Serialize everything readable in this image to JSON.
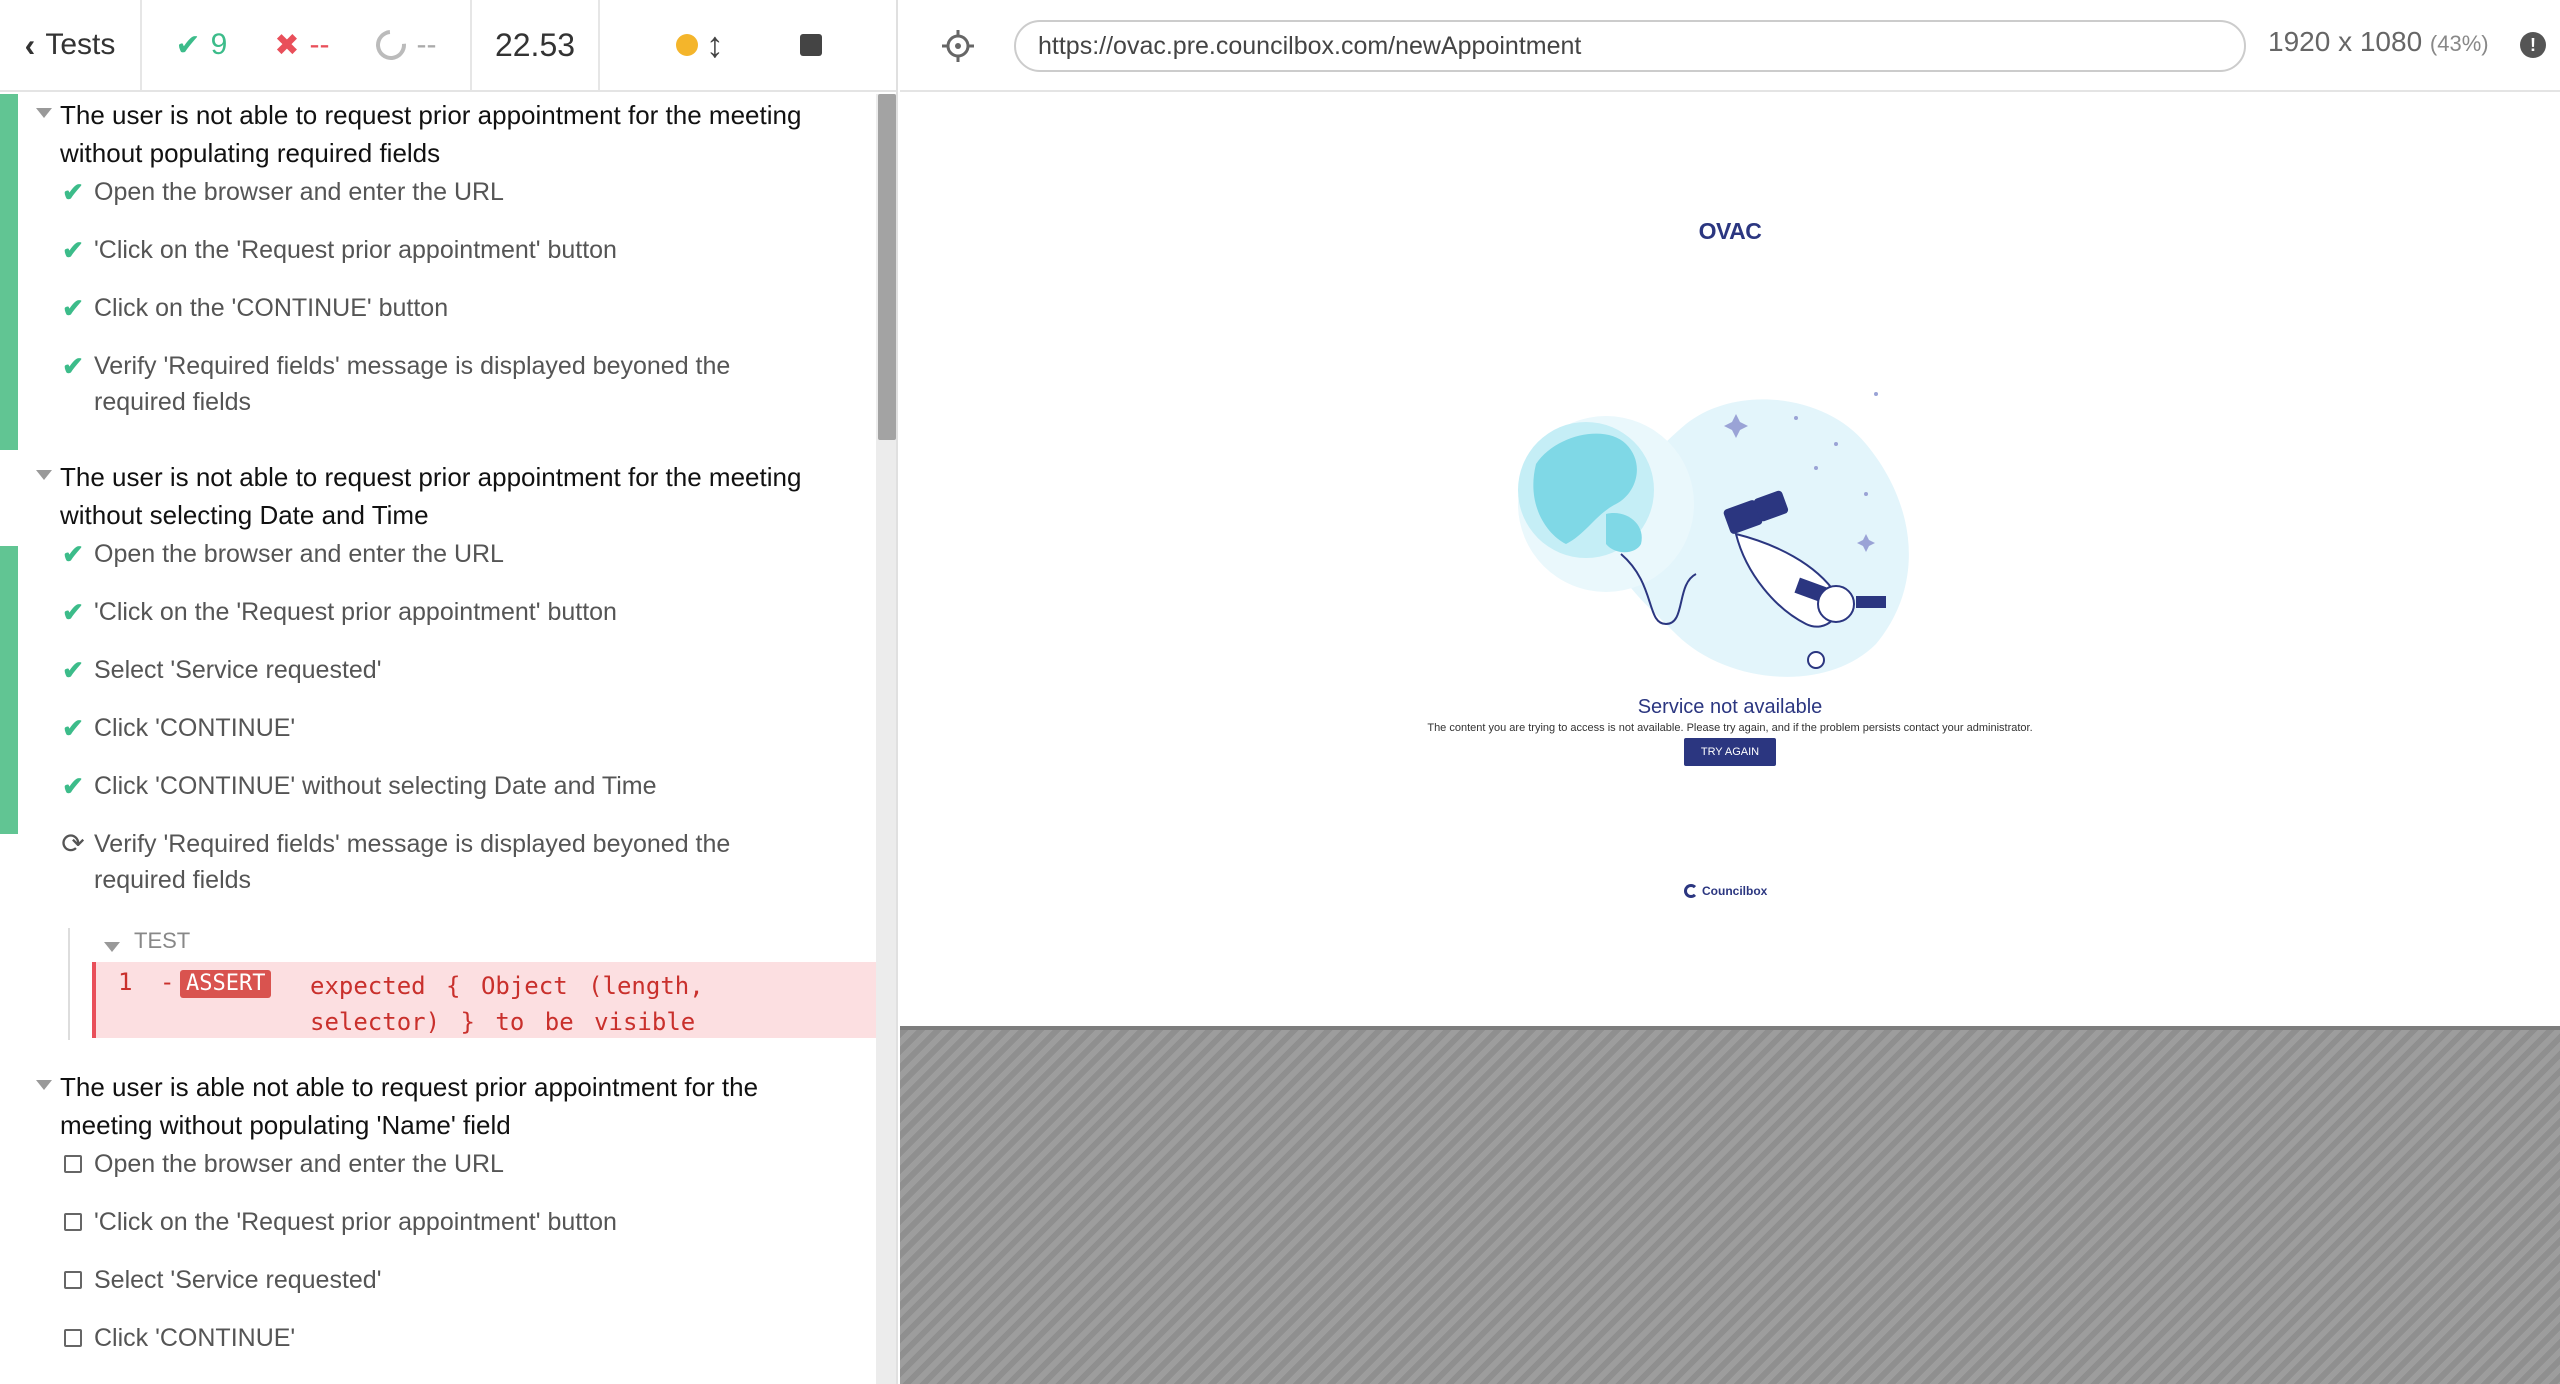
{
  "header": {
    "tests_label": "Tests",
    "passed": "9",
    "failed": "--",
    "pending": "--",
    "duration": "22.53"
  },
  "aut": {
    "url": "https://ovac.pre.councilbox.com/newAppointment",
    "viewport": "1920 x 1080",
    "scale": "(43%)",
    "page": {
      "logo": "OVAC",
      "error_title": "Service not available",
      "error_description": "The content you are trying to access is not available. Please try again, and if the problem persists contact your administrator.",
      "try_again": "TRY AGAIN",
      "footer_logo": "Councilbox"
    }
  },
  "tests": [
    {
      "title": "The user is not able to request prior appointment for the meeting without populating required fields",
      "steps": [
        {
          "state": "passed",
          "label": "Open the browser and enter the URL"
        },
        {
          "state": "passed",
          "label": "'Click on the 'Request prior appointment' button"
        },
        {
          "state": "passed",
          "label": "Click on the 'CONTINUE' button"
        },
        {
          "state": "passed",
          "label": "Verify 'Required fields' message is displayed beyoned the required fields"
        }
      ]
    },
    {
      "title": "The user is not able to request prior appointment for the meeting without selecting Date and Time",
      "steps": [
        {
          "state": "passed",
          "label": "Open the browser and enter the URL"
        },
        {
          "state": "passed",
          "label": "'Click on the 'Request prior appointment' button"
        },
        {
          "state": "passed",
          "label": "Select 'Service requested'"
        },
        {
          "state": "passed",
          "label": "Click 'CONTINUE'"
        },
        {
          "state": "passed",
          "label": "Click 'CONTINUE' without selecting Date and Time"
        },
        {
          "state": "running",
          "label": "Verify 'Required fields' message is displayed beyoned the required fields"
        }
      ],
      "hook": {
        "label": "TEST",
        "command": {
          "number": "1",
          "dash": "-",
          "name": "ASSERT",
          "message": "expected { Object (length, selector) } to be visible"
        }
      }
    },
    {
      "title": "The user is able not able to request prior appointment for the meeting without populating 'Name' field",
      "steps": [
        {
          "state": "pending",
          "label": "Open the browser and enter the URL"
        },
        {
          "state": "pending",
          "label": "'Click on the 'Request prior appointment' button"
        },
        {
          "state": "pending",
          "label": "Select 'Service requested'"
        },
        {
          "state": "pending",
          "label": "Click 'CONTINUE'"
        }
      ]
    }
  ]
}
